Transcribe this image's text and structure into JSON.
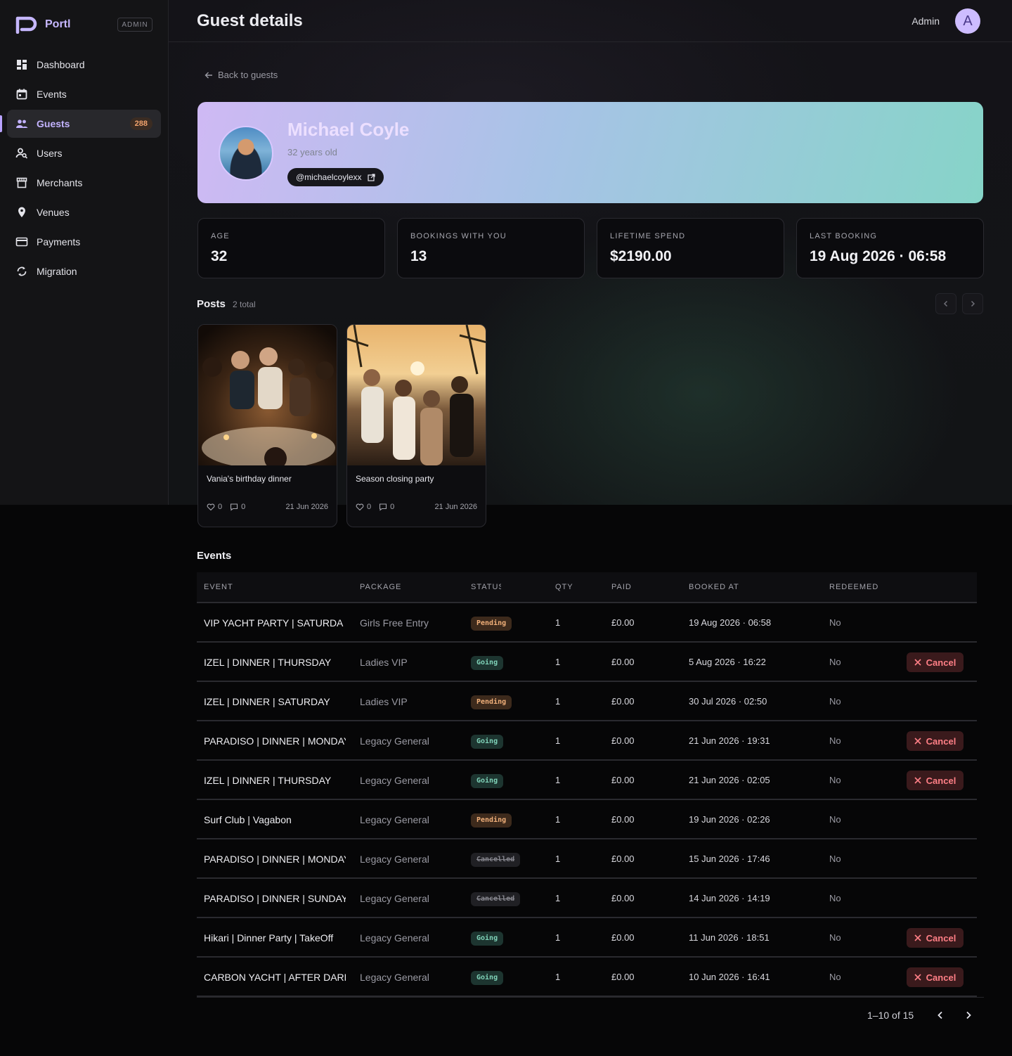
{
  "brand": {
    "name": "Portl",
    "role_tag": "ADMIN"
  },
  "sidebar": {
    "items": [
      {
        "label": "Dashboard",
        "icon": "dashboard-icon"
      },
      {
        "label": "Events",
        "icon": "calendar-icon"
      },
      {
        "label": "Guests",
        "icon": "people-icon",
        "badge": "288",
        "active": true
      },
      {
        "label": "Users",
        "icon": "user-search-icon"
      },
      {
        "label": "Merchants",
        "icon": "store-icon"
      },
      {
        "label": "Venues",
        "icon": "location-pin-icon"
      },
      {
        "label": "Payments",
        "icon": "credit-card-icon"
      },
      {
        "label": "Migration",
        "icon": "sync-icon"
      }
    ]
  },
  "header": {
    "title": "Guest details",
    "user_name": "Admin",
    "user_initial": "A"
  },
  "back_link": "Back to guests",
  "guest": {
    "name": "Michael Coyle",
    "age_text": "32 years old",
    "handle": "@michaelcoylexx"
  },
  "stats": [
    {
      "label": "AGE",
      "value": "32"
    },
    {
      "label": "BOOKINGS WITH YOU",
      "value": "13"
    },
    {
      "label": "LIFETIME SPEND",
      "value": "$2190.00"
    },
    {
      "label": "LAST BOOKING",
      "value": "19 Aug 2026 · 06:58"
    }
  ],
  "posts": {
    "title": "Posts",
    "count_text": "2 total",
    "items": [
      {
        "caption": "Vania's birthday dinner",
        "likes": "0",
        "comments": "0",
        "date": "21 Jun 2026"
      },
      {
        "caption": "Season closing party",
        "likes": "0",
        "comments": "0",
        "date": "21 Jun 2026"
      }
    ]
  },
  "events": {
    "title": "Events",
    "columns": [
      "EVENT",
      "PACKAGE",
      "STATUS",
      "QTY",
      "PAID",
      "BOOKED AT",
      "REDEEMED"
    ],
    "cancel_label": "Cancel",
    "rows": [
      {
        "event": "VIP YACHT PARTY | SATURDA",
        "package": "Girls Free Entry",
        "status": "Pending",
        "qty": "1",
        "paid": "£0.00",
        "booked_at": "19 Aug 2026 · 06:58",
        "redeemed": "No",
        "cancellable": false
      },
      {
        "event": "IZEL | DINNER | THURSDAY",
        "package": "Ladies VIP",
        "status": "Going",
        "qty": "1",
        "paid": "£0.00",
        "booked_at": "5 Aug 2026 · 16:22",
        "redeemed": "No",
        "cancellable": true
      },
      {
        "event": "IZEL | DINNER | SATURDAY",
        "package": "Ladies VIP",
        "status": "Pending",
        "qty": "1",
        "paid": "£0.00",
        "booked_at": "30 Jul 2026 · 02:50",
        "redeemed": "No",
        "cancellable": false
      },
      {
        "event": "PARADISO | DINNER | MONDAY",
        "package": "Legacy General",
        "status": "Going",
        "qty": "1",
        "paid": "£0.00",
        "booked_at": "21 Jun 2026 · 19:31",
        "redeemed": "No",
        "cancellable": true
      },
      {
        "event": "IZEL | DINNER | THURSDAY",
        "package": "Legacy General",
        "status": "Going",
        "qty": "1",
        "paid": "£0.00",
        "booked_at": "21 Jun 2026 · 02:05",
        "redeemed": "No",
        "cancellable": true
      },
      {
        "event": "Surf Club | Vagabon",
        "package": "Legacy General",
        "status": "Pending",
        "qty": "1",
        "paid": "£0.00",
        "booked_at": "19 Jun 2026 · 02:26",
        "redeemed": "No",
        "cancellable": false
      },
      {
        "event": "PARADISO | DINNER | MONDAY",
        "package": "Legacy General",
        "status": "Cancelled",
        "qty": "1",
        "paid": "£0.00",
        "booked_at": "15 Jun 2026 · 17:46",
        "redeemed": "No",
        "cancellable": false
      },
      {
        "event": "PARADISO | DINNER | SUNDAY",
        "package": "Legacy General",
        "status": "Cancelled",
        "qty": "1",
        "paid": "£0.00",
        "booked_at": "14 Jun 2026 · 14:19",
        "redeemed": "No",
        "cancellable": false
      },
      {
        "event": "Hikari | Dinner Party | TakeOff",
        "package": "Legacy General",
        "status": "Going",
        "qty": "1",
        "paid": "£0.00",
        "booked_at": "11 Jun 2026 · 18:51",
        "redeemed": "No",
        "cancellable": true
      },
      {
        "event": "CARBON YACHT | AFTER DARK",
        "package": "Legacy General",
        "status": "Going",
        "qty": "1",
        "paid": "£0.00",
        "booked_at": "10 Jun 2026 · 16:41",
        "redeemed": "No",
        "cancellable": true
      }
    ],
    "pagination_text": "1–10 of 15"
  },
  "colors": {
    "accent": "#c3b3ff",
    "pending": "#f1b07a",
    "going": "#7fd2b8",
    "danger": "#ff7f86"
  }
}
